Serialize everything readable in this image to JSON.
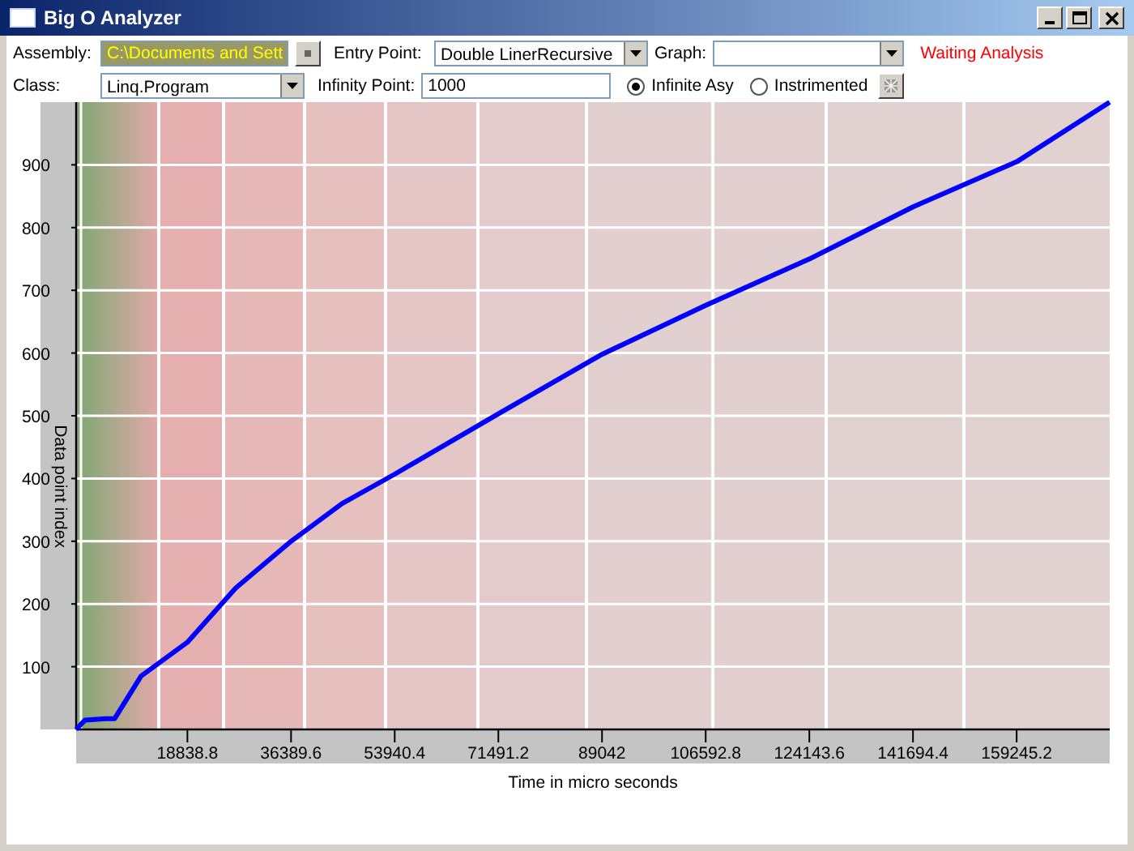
{
  "window": {
    "title": "Big O Analyzer"
  },
  "toolbar": {
    "assembly": {
      "label": "Assembly:",
      "value": "C:\\Documents and Sett"
    },
    "entry_point": {
      "label": "Entry Point:",
      "value": "Double LinerRecursive"
    },
    "graph": {
      "label": "Graph:"
    },
    "status": "Waiting Analysis",
    "class": {
      "label": "Class:",
      "value": "Linq.Program"
    },
    "infinity_point": {
      "label": "Infinity Point:",
      "value": "1000"
    },
    "modes": [
      {
        "label": "Infinite Asy",
        "selected": true
      },
      {
        "label": "Instrimented",
        "selected": false
      }
    ]
  },
  "chart": {
    "chart_data": {
      "type": "line",
      "grid": true,
      "xlabel": "Time in micro seconds",
      "ylabel": "Data point index",
      "xlim": [
        0,
        175000
      ],
      "ylim": [
        0,
        1000
      ],
      "xticks": [
        18838.8,
        36389.6,
        53940.4,
        71491.2,
        89042,
        106592.8,
        124143.6,
        141694.4,
        159245.2
      ],
      "yticks": [
        100,
        200,
        300,
        400,
        500,
        600,
        700,
        800,
        900
      ],
      "x": [
        0,
        1500,
        5000,
        6500,
        11000,
        18838.8,
        27000,
        36389.6,
        45000,
        53940.4,
        71491.2,
        89042,
        106592.8,
        124143.6,
        141694.4,
        159245.2,
        175000
      ],
      "series": [
        {
          "color": "#0000ff",
          "values": [
            0,
            15,
            17,
            17,
            85,
            139,
            225,
            300,
            360,
            407,
            503,
            598,
            676,
            750,
            833,
            905,
            1000
          ]
        }
      ]
    }
  }
}
